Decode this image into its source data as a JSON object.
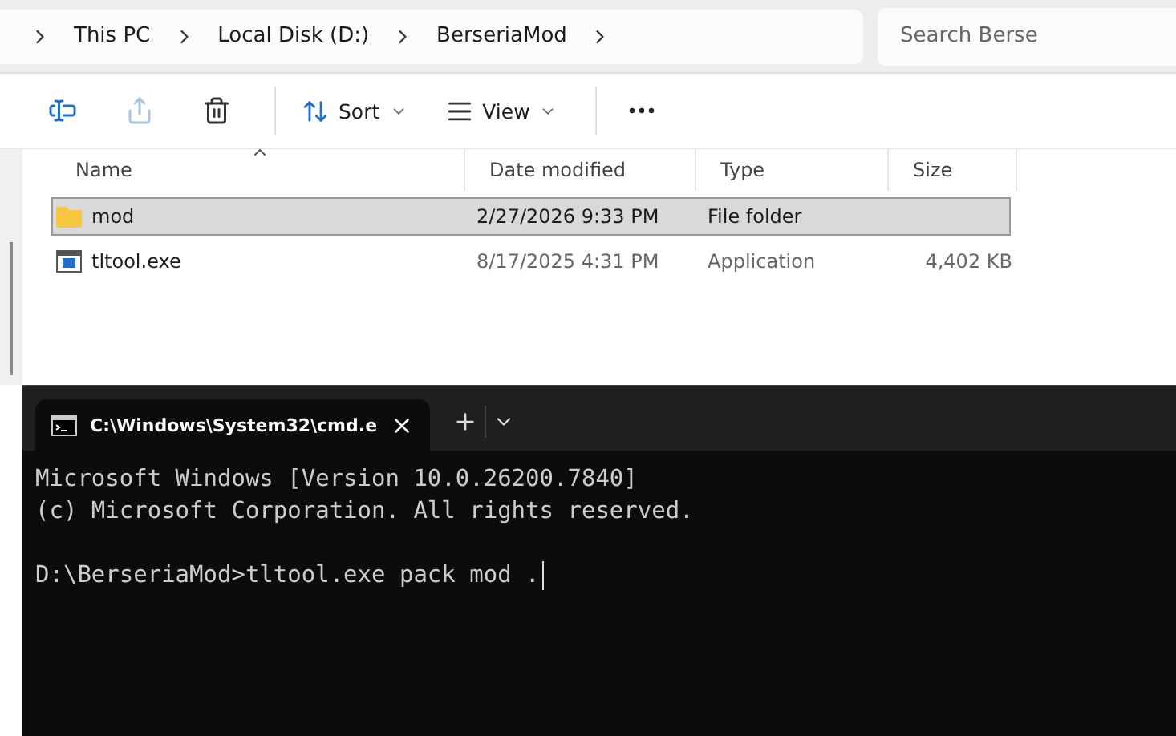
{
  "explorer": {
    "breadcrumbs": [
      "This PC",
      "Local Disk (D:)",
      "BerseriaMod"
    ],
    "search": {
      "placeholder": "Search Berse"
    },
    "toolbar": [
      {
        "kind": "rename",
        "disabled": false
      },
      {
        "kind": "share",
        "disabled": true
      },
      {
        "kind": "delete",
        "disabled": false
      },
      {
        "kind": "sort",
        "label": "Sort"
      },
      {
        "kind": "view",
        "label": "View"
      },
      {
        "kind": "more"
      }
    ],
    "columns": [
      "Name",
      "Date modified",
      "Type",
      "Size"
    ],
    "rows": [
      {
        "kind": "folder",
        "name": "mod",
        "date": "2/27/2026 9:33 PM",
        "type": "File folder",
        "selected": true
      },
      {
        "kind": "app",
        "name": "tltool.exe",
        "date": "8/17/2025 4:31 PM",
        "type": "Application",
        "size": "4,402 KB",
        "selected": false
      }
    ]
  },
  "terminal": {
    "tabs": [
      {
        "title": "C:\\Windows\\System32\\cmd.e",
        "selected": true
      }
    ],
    "lines": [
      {
        "kind": "text",
        "text": "Microsoft Windows [Version 10.0.26200.7840]"
      },
      {
        "kind": "text",
        "text": "(c) Microsoft Corporation. All rights reserved."
      },
      {
        "kind": "blank"
      },
      {
        "kind": "prompt",
        "text": "D:\\BerseriaMod>tltool.exe pack mod ."
      }
    ]
  }
}
